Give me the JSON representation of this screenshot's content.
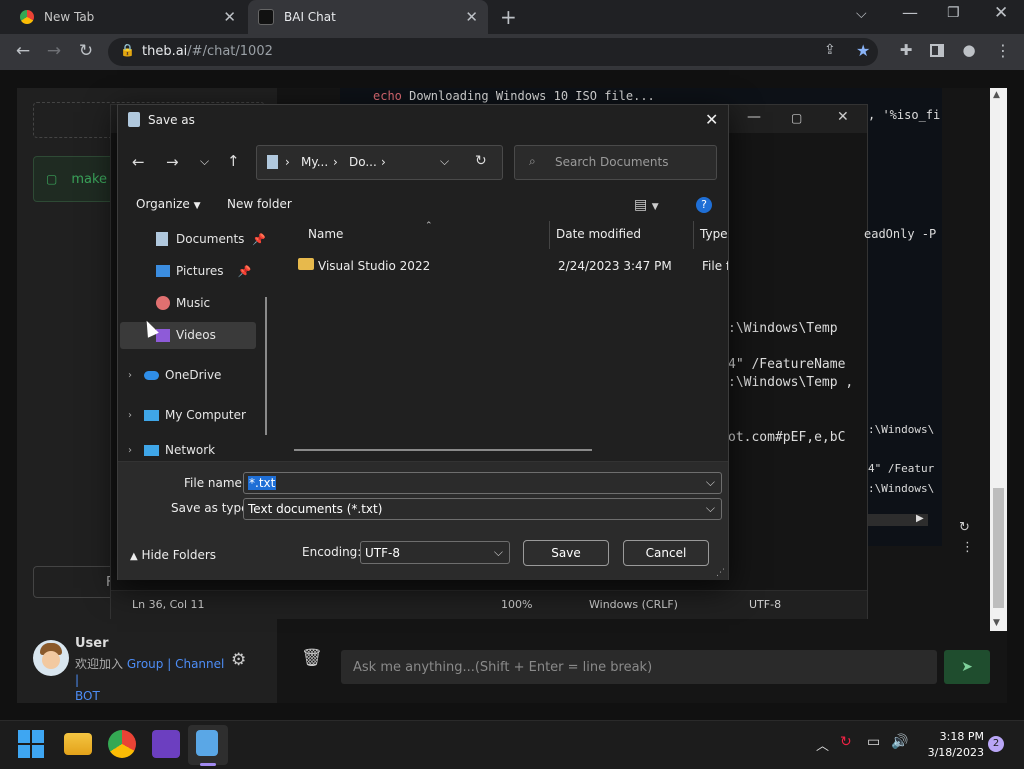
{
  "browser": {
    "tabs": [
      {
        "title": "New Tab",
        "active": false
      },
      {
        "title": "BAI Chat",
        "active": true
      }
    ],
    "new_tab_label": "+",
    "url_host": "theb.ai",
    "url_path": "/#/chat/1002"
  },
  "chat": {
    "sidebar_item": "make",
    "user_name": "User",
    "user_line1_prefix": "欢迎加入",
    "link_group": "Group",
    "link_channel": "Channel",
    "link_bot": "BOT",
    "separator": "|",
    "input_placeholder": "Ask me anything...(Shift + Enter = line break)",
    "sidebar_button_text": "F"
  },
  "editor_bg": {
    "code_line1_kw": "echo",
    "code_line1_rest": " Downloading Windows 10 ISO file...",
    "frag_isofi": ", '%iso_fi",
    "frag_readonly": "eadOnly -P",
    "frag_temp1": ":\\Windows\\Temp",
    "frag_feature": "4\" /FeatureName",
    "frag_temp2": ":\\Windows\\Temp ,",
    "frag_windows1": ":\\Windows\\",
    "frag_otcom": "ot.com#pEF,e,bC",
    "frag_featur2": "4\" /Featur",
    "frag_windows2": ":\\Windows\\",
    "status_pos": "Ln 36, Col 11",
    "status_zoom": "100%",
    "status_eol": "Windows (CRLF)",
    "status_enc": "UTF-8"
  },
  "dialog": {
    "title": "Save as",
    "breadcrumb": [
      "My...",
      "Do..."
    ],
    "search_placeholder": "Search Documents",
    "organize": "Organize",
    "new_folder": "New folder",
    "nav": [
      {
        "label": "Documents",
        "pinned": true
      },
      {
        "label": "Pictures",
        "pinned": true
      },
      {
        "label": "Music",
        "pinned": false
      },
      {
        "label": "Videos",
        "pinned": false,
        "selected": true
      },
      {
        "label": "OneDrive",
        "expandable": true
      },
      {
        "label": "My Computer",
        "expandable": true
      },
      {
        "label": "Network",
        "expandable": true
      }
    ],
    "columns": [
      "Name",
      "Date modified",
      "Type"
    ],
    "files": [
      {
        "name": "Visual Studio 2022",
        "modified": "2/24/2023 3:47 PM",
        "type": "File fo"
      }
    ],
    "file_name_label": "File name:",
    "file_name_value": "*.txt",
    "save_type_label": "Save as type:",
    "save_type_value": "Text documents (*.txt)",
    "hide_folders": "Hide Folders",
    "encoding_label": "Encoding:",
    "encoding_value": "UTF-8",
    "save": "Save",
    "cancel": "Cancel"
  },
  "taskbar": {
    "time": "3:18 PM",
    "date": "3/18/2023",
    "notifications": "2"
  }
}
